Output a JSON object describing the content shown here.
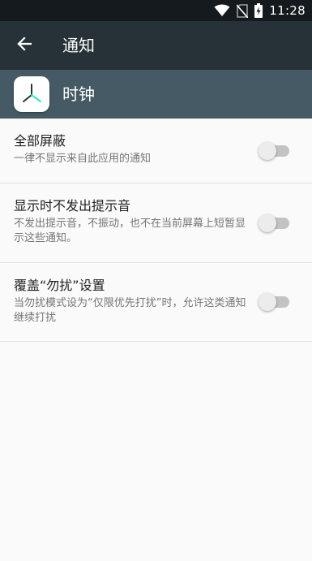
{
  "status_bar": {
    "time": "11:28",
    "icons": [
      "wifi-icon",
      "no-sim-icon",
      "battery-charging-icon"
    ]
  },
  "toolbar": {
    "back_icon": "back-arrow-icon",
    "title": "通知"
  },
  "app": {
    "name": "时钟",
    "icon": "clock-app-icon"
  },
  "settings": [
    {
      "title": "全部屏蔽",
      "summary": "一律不显示来自此应用的通知",
      "enabled": false
    },
    {
      "title": "显示时不发出提示音",
      "summary": "不发出提示音，不振动，也不在当前屏幕上短暂显示这些通知。",
      "enabled": false
    },
    {
      "title": "覆盖“勿扰”设置",
      "summary": "当勿扰模式设为“仅限优先打扰”时，允许这类通知继续打扰",
      "enabled": false
    }
  ],
  "colors": {
    "toolbar": "#263238",
    "app_header": "#455a64",
    "status_bar": "#141a1d",
    "background": "#fafafa"
  }
}
